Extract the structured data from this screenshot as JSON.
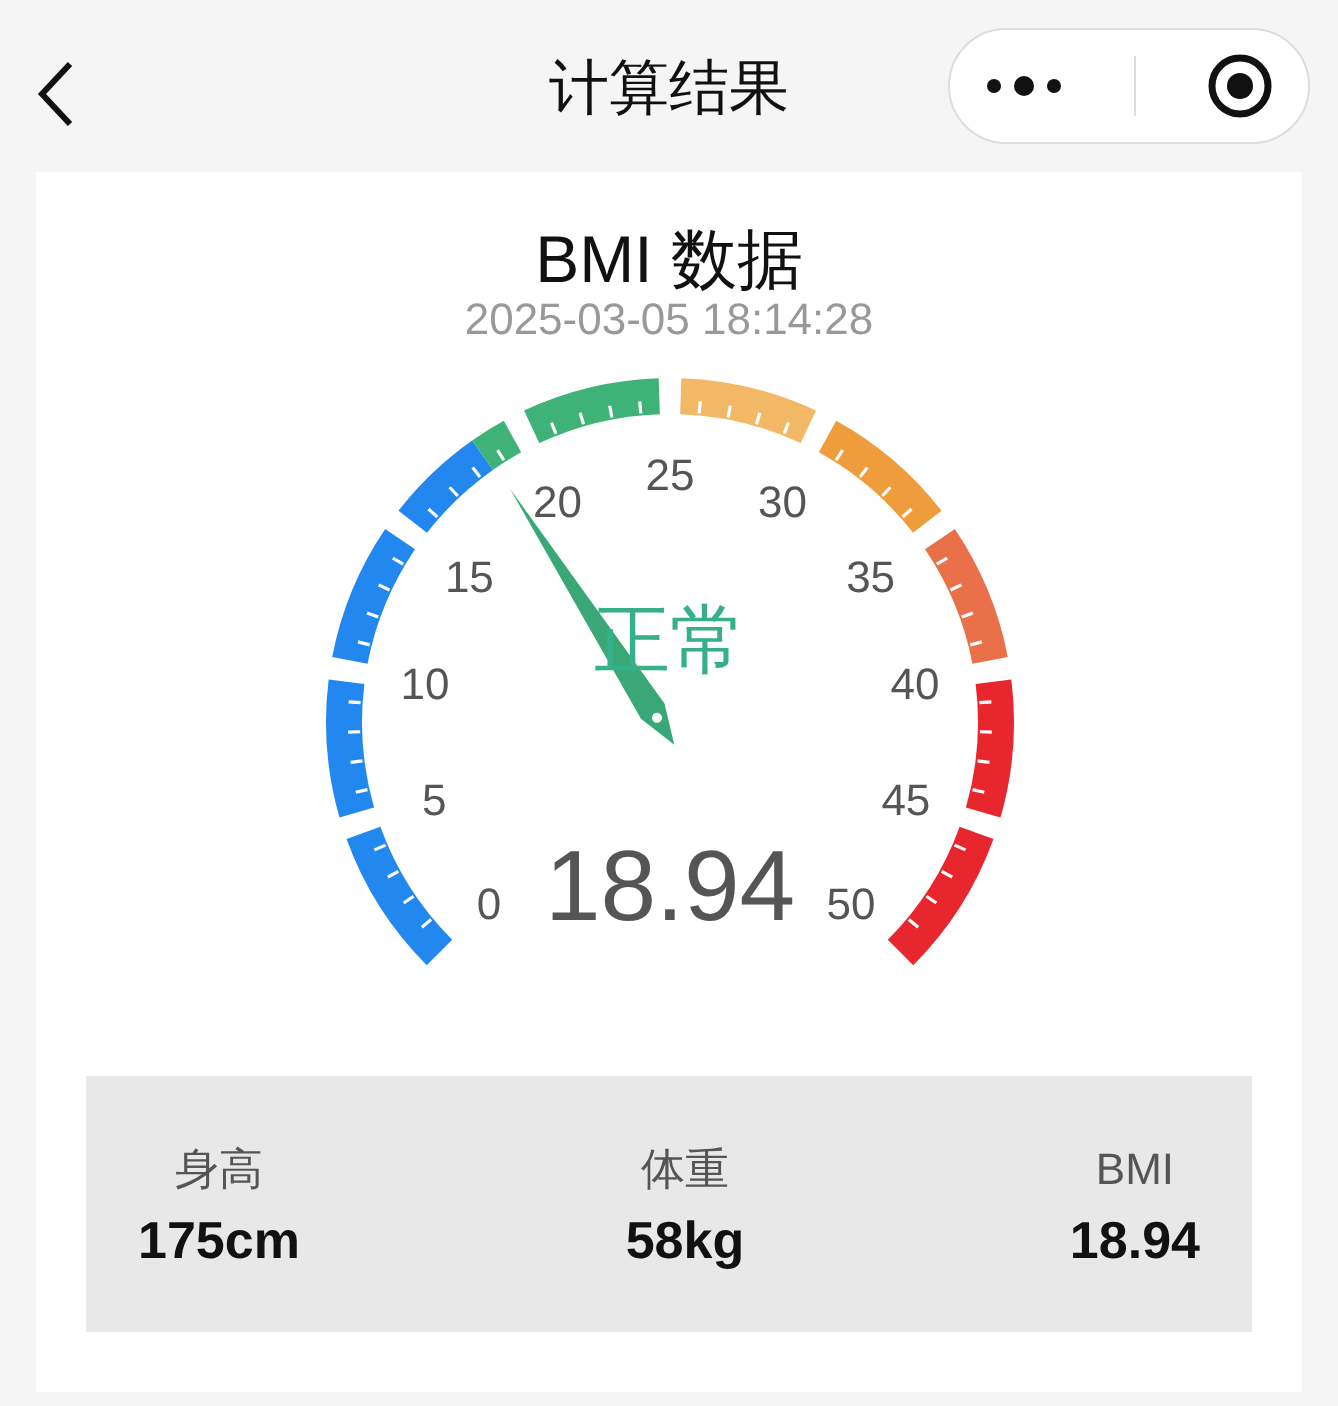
{
  "nav": {
    "title": "计算结果"
  },
  "card": {
    "title": "BMI 数据",
    "timestamp": "2025-03-05 18:14:28"
  },
  "gauge": {
    "status": "正常",
    "value": "18.94",
    "ticks": [
      "0",
      "5",
      "10",
      "15",
      "20",
      "25",
      "30",
      "35",
      "40",
      "45",
      "50"
    ],
    "bands": [
      {
        "color": "#2288f0"
      },
      {
        "color": "#3fb277"
      },
      {
        "color": "#f2b866"
      },
      {
        "color": "#ee9c3c"
      },
      {
        "color": "#ea704a"
      },
      {
        "color": "#e8262e"
      }
    ]
  },
  "stats": [
    {
      "label": "身高",
      "value": "175cm"
    },
    {
      "label": "体重",
      "value": "58kg"
    },
    {
      "label": "BMI",
      "value": "18.94"
    }
  ]
}
